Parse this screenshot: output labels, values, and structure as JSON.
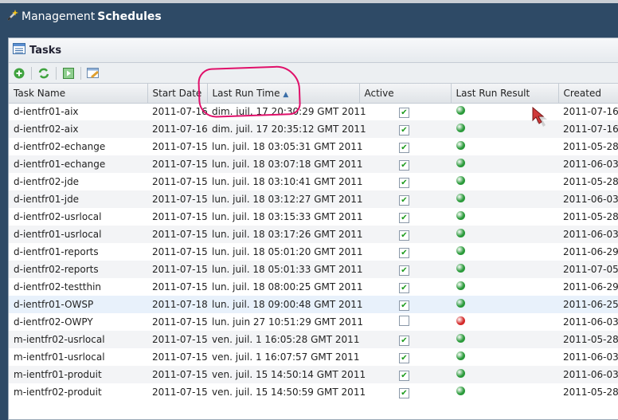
{
  "app": {
    "title_prefix": "Management",
    "title_bold": "Schedules"
  },
  "panel": {
    "title": "Tasks"
  },
  "toolbar": {
    "icons": [
      "add-icon",
      "refresh-icon",
      "run-icon",
      "edit-icon"
    ]
  },
  "columns": [
    "Task Name",
    "Start Date",
    "Last Run Time",
    "Active",
    "Last Run Result",
    "Created"
  ],
  "sort": {
    "column": "Last Run Time",
    "direction": "ascending"
  },
  "colors": {
    "header": "#2e4a66",
    "success": "#2a9a3a",
    "failure": "#d42a2a",
    "annotation": "#e0106a"
  },
  "rows": [
    {
      "name": "d-ientfr01-aix",
      "start": "2011-07-16",
      "last": "dim. juil. 17 20:30:29 GMT 2011",
      "active": true,
      "result": "success",
      "created": "2011-07-16"
    },
    {
      "name": "d-ientfr02-aix",
      "start": "2011-07-16",
      "last": "dim. juil. 17 20:35:12 GMT 2011",
      "active": true,
      "result": "success",
      "created": "2011-07-16"
    },
    {
      "name": "d-ientfr02-echange",
      "start": "2011-07-15",
      "last": "lun. juil. 18 03:05:31 GMT 2011",
      "active": true,
      "result": "success",
      "created": "2011-05-28"
    },
    {
      "name": "d-ientfr01-echange",
      "start": "2011-07-15",
      "last": "lun. juil. 18 03:07:18 GMT 2011",
      "active": true,
      "result": "success",
      "created": "2011-06-03"
    },
    {
      "name": "d-ientfr02-jde",
      "start": "2011-07-15",
      "last": "lun. juil. 18 03:10:41 GMT 2011",
      "active": true,
      "result": "success",
      "created": "2011-05-28"
    },
    {
      "name": "d-ientfr01-jde",
      "start": "2011-07-15",
      "last": "lun. juil. 18 03:12:27 GMT 2011",
      "active": true,
      "result": "success",
      "created": "2011-06-03"
    },
    {
      "name": "d-ientfr02-usrlocal",
      "start": "2011-07-15",
      "last": "lun. juil. 18 03:15:33 GMT 2011",
      "active": true,
      "result": "success",
      "created": "2011-05-28"
    },
    {
      "name": "d-ientfr01-usrlocal",
      "start": "2011-07-15",
      "last": "lun. juil. 18 03:17:26 GMT 2011",
      "active": true,
      "result": "success",
      "created": "2011-06-03"
    },
    {
      "name": "d-ientfr01-reports",
      "start": "2011-07-15",
      "last": "lun. juil. 18 05:01:20 GMT 2011",
      "active": true,
      "result": "success",
      "created": "2011-06-29"
    },
    {
      "name": "d-ientfr02-reports",
      "start": "2011-07-15",
      "last": "lun. juil. 18 05:01:33 GMT 2011",
      "active": true,
      "result": "success",
      "created": "2011-07-05"
    },
    {
      "name": "d-ientfr02-testthin",
      "start": "2011-07-15",
      "last": "lun. juil. 18 08:00:25 GMT 2011",
      "active": true,
      "result": "success",
      "created": "2011-06-29"
    },
    {
      "name": "d-ientfr01-OWSP",
      "start": "2011-07-18",
      "last": "lun. juil. 18 09:00:48 GMT 2011",
      "active": true,
      "result": "success",
      "created": "2011-06-25",
      "selected": true
    },
    {
      "name": "d-ientfr02-OWPY",
      "start": "2011-07-15",
      "last": "lun. juin 27 10:51:29 GMT 2011",
      "active": false,
      "result": "failure",
      "created": "2011-06-03"
    },
    {
      "name": "m-ientfr02-usrlocal",
      "start": "2011-07-15",
      "last": "ven. juil. 1 16:05:28 GMT 2011",
      "active": true,
      "result": "success",
      "created": "2011-05-28"
    },
    {
      "name": "m-ientfr01-usrlocal",
      "start": "2011-07-15",
      "last": "ven. juil. 1 16:07:57 GMT 2011",
      "active": true,
      "result": "success",
      "created": "2011-06-03"
    },
    {
      "name": "m-ientfr01-produit",
      "start": "2011-07-15",
      "last": "ven. juil. 15 14:50:14 GMT 2011",
      "active": true,
      "result": "success",
      "created": "2011-06-03"
    },
    {
      "name": "m-ientfr02-produit",
      "start": "2011-07-15",
      "last": "ven. juil. 15 14:50:59 GMT 2011",
      "active": true,
      "result": "success",
      "created": "2011-05-28"
    }
  ]
}
